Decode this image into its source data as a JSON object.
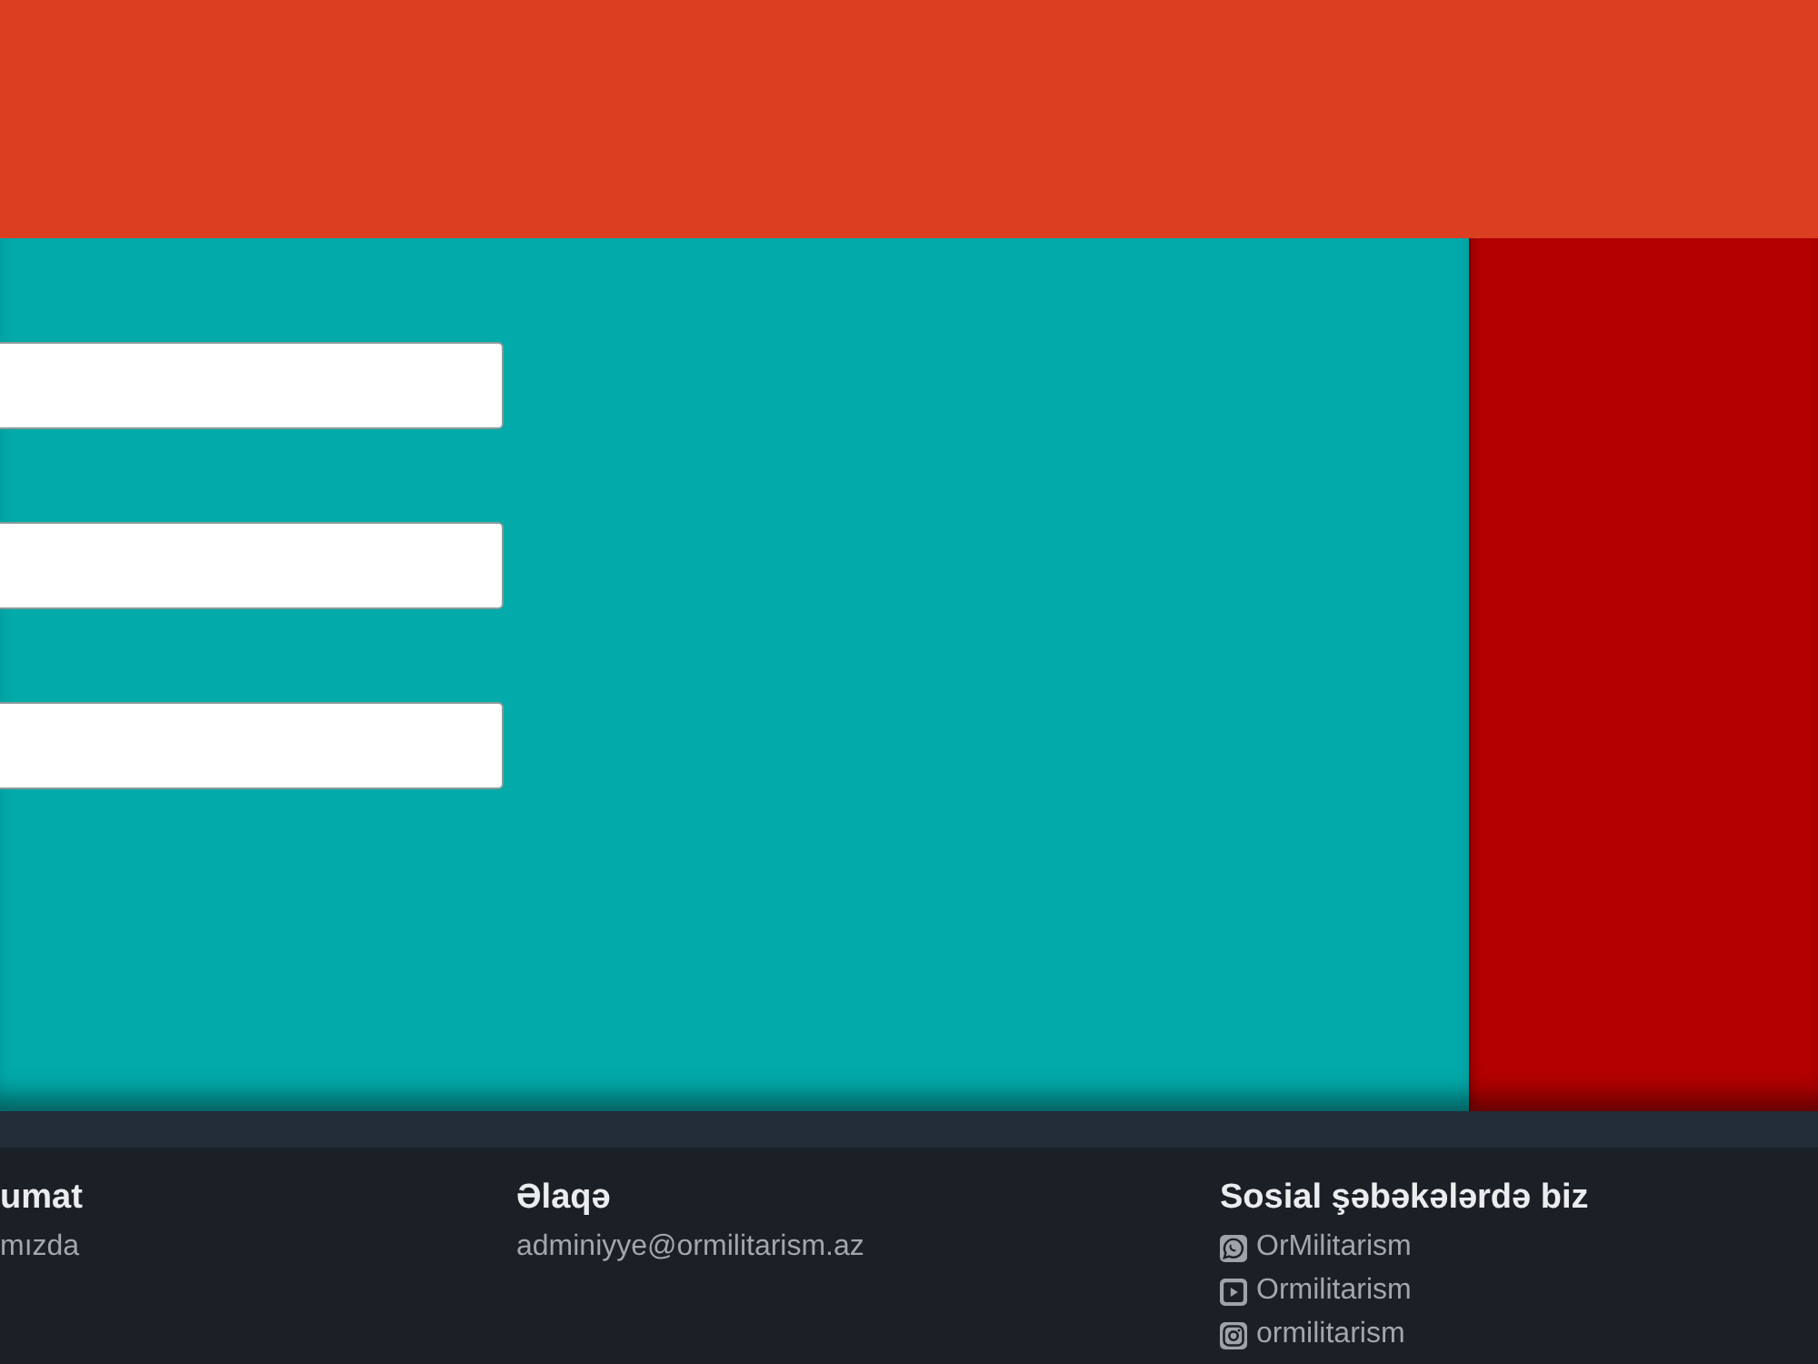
{
  "form": {
    "fields": [
      {
        "kind": "text"
      },
      {
        "kind": "text"
      },
      {
        "kind": "text"
      }
    ]
  },
  "footer": {
    "columns": [
      {
        "heading": "umat",
        "lines": [
          {
            "kind": "link",
            "text": "mızda"
          }
        ]
      },
      {
        "heading": "Əlaqə",
        "lines": [
          {
            "kind": "link",
            "text": "adminiyye@ormilitarism.az"
          }
        ]
      },
      {
        "heading": "Sosial şəbəkələrdə biz",
        "lines": [
          {
            "kind": "chat",
            "text": "OrMilitarism"
          },
          {
            "kind": "video",
            "text": "Ormilitarism"
          },
          {
            "kind": "camera",
            "text": "ormilitarism"
          }
        ]
      }
    ]
  }
}
